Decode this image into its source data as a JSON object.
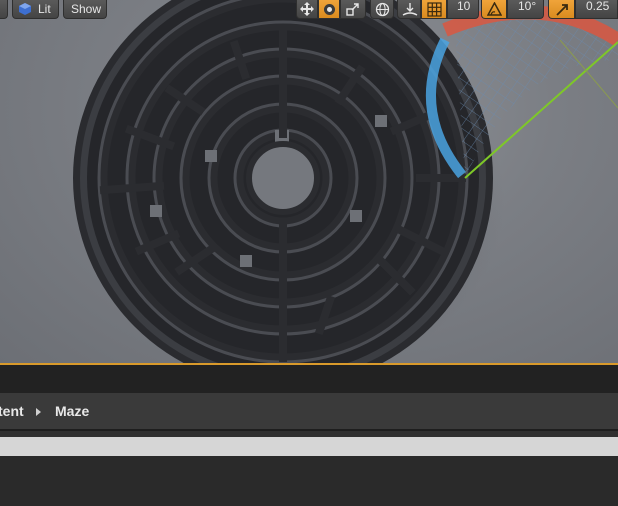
{
  "viewport": {
    "toolbar": {
      "lit_label": "Lit",
      "show_label": "Show",
      "grid_snap_value": "10",
      "rotation_snap_value": "10°",
      "scale_snap_value": "0.25"
    },
    "icons": [
      "view-mode-icon",
      "show-icon",
      "translate-icon",
      "rotate-icon",
      "scale-icon",
      "world-local-icon",
      "surface-snap-icon",
      "grid-snap-icon",
      "rotation-snap-icon",
      "scale-snap-icon"
    ],
    "colors": {
      "accent": "#d99a2b",
      "rotation_gizmo_red": "#e0553c",
      "rotation_gizmo_blue": "#4aa3e0",
      "rotation_gizmo_green": "#7ec828"
    }
  },
  "content_browser": {
    "breadcrumb": [
      "tent",
      "Maze"
    ]
  }
}
